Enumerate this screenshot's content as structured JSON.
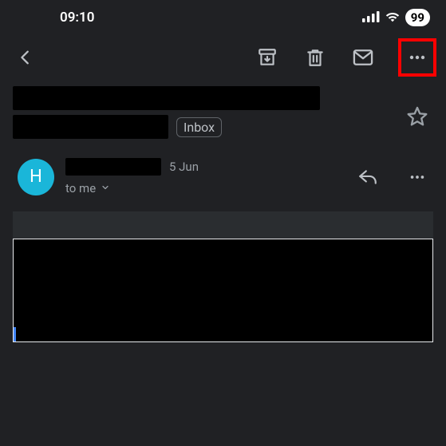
{
  "status": {
    "time": "09:10",
    "battery_pct": "99"
  },
  "toolbar": {
    "back_label": "Back",
    "archive_label": "Archive",
    "delete_label": "Delete",
    "mark_unread_label": "Mark unread",
    "more_label": "More options"
  },
  "subject": {
    "line1_redacted": true,
    "line2_redacted": true,
    "folder": "Inbox",
    "star_label": "Star"
  },
  "sender": {
    "avatar_letter": "H",
    "avatar_color": "#1ab6d9",
    "name_redacted": true,
    "date": "5 Jun",
    "recipient_text": "to me",
    "expand_label": "Expand details",
    "reply_label": "Reply",
    "more_label": "More"
  },
  "body": {
    "redacted": true
  }
}
